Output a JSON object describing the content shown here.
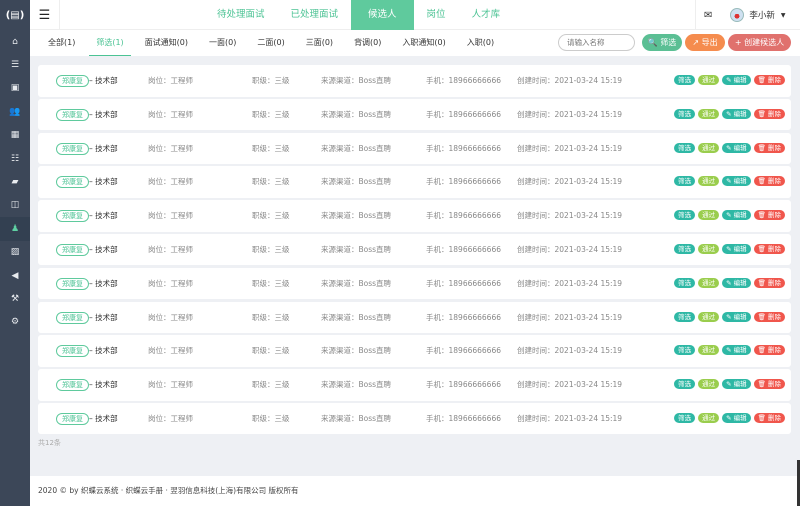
{
  "sidebar": {
    "logo": "(▤)",
    "items": [
      {
        "icon": "home-icon",
        "glyph": "⌂"
      },
      {
        "icon": "list-icon",
        "glyph": "☰"
      },
      {
        "icon": "briefcase-icon",
        "glyph": "▣"
      },
      {
        "icon": "users-icon",
        "glyph": "👥"
      },
      {
        "icon": "calendar-icon",
        "glyph": "▦"
      },
      {
        "icon": "table-icon",
        "glyph": "☷"
      },
      {
        "icon": "book-icon",
        "glyph": "▰"
      },
      {
        "icon": "columns-icon",
        "glyph": "◫"
      },
      {
        "icon": "person-icon",
        "glyph": "♟"
      },
      {
        "icon": "image-icon",
        "glyph": "▨"
      },
      {
        "icon": "bullhorn-icon",
        "glyph": "◀"
      },
      {
        "icon": "gavel-icon",
        "glyph": "⚒"
      },
      {
        "icon": "cogs-icon",
        "glyph": "⚙"
      }
    ],
    "active_index": 8
  },
  "header": {
    "nav": [
      "待处理面试",
      "已处理面试",
      "候选人",
      "岗位",
      "人才库"
    ],
    "active_nav": 2,
    "user": "李小新"
  },
  "tabs": [
    "全部(1)",
    "筛选(1)",
    "面试通知(0)",
    "一面(0)",
    "二面(0)",
    "三面(0)",
    "背调(0)",
    "入职通知(0)",
    "入职(0)"
  ],
  "active_tab": 1,
  "search": {
    "placeholder": "请输入名称"
  },
  "actions": {
    "filter": "🔍 筛选",
    "export": "↗ 导出",
    "create": "+ 创建候选人"
  },
  "row_ops": {
    "filter": "筛选",
    "pass": "通过",
    "edit": "✎ 编辑",
    "delete": "🗑 删除"
  },
  "rows": [
    {
      "name": "郑康复",
      "dept": "– 技术部",
      "position": "岗位：工程师",
      "level": "职级：三级",
      "source": "来源渠道：Boss直聘",
      "phone": "手机：18966666666",
      "created": "创建时间：2021-03-24 15:19"
    },
    {
      "name": "郑康复",
      "dept": "– 技术部",
      "position": "岗位：工程师",
      "level": "职级：三级",
      "source": "来源渠道：Boss直聘",
      "phone": "手机：18966666666",
      "created": "创建时间：2021-03-24 15:19"
    },
    {
      "name": "郑康复",
      "dept": "– 技术部",
      "position": "岗位：工程师",
      "level": "职级：三级",
      "source": "来源渠道：Boss直聘",
      "phone": "手机：18966666666",
      "created": "创建时间：2021-03-24 15:19"
    },
    {
      "name": "郑康复",
      "dept": "– 技术部",
      "position": "岗位：工程师",
      "level": "职级：三级",
      "source": "来源渠道：Boss直聘",
      "phone": "手机：18966666666",
      "created": "创建时间：2021-03-24 15:19"
    },
    {
      "name": "郑康复",
      "dept": "– 技术部",
      "position": "岗位：工程师",
      "level": "职级：三级",
      "source": "来源渠道：Boss直聘",
      "phone": "手机：18966666666",
      "created": "创建时间：2021-03-24 15:19"
    },
    {
      "name": "郑康复",
      "dept": "– 技术部",
      "position": "岗位：工程师",
      "level": "职级：三级",
      "source": "来源渠道：Boss直聘",
      "phone": "手机：18966666666",
      "created": "创建时间：2021-03-24 15:19"
    },
    {
      "name": "郑康复",
      "dept": "– 技术部",
      "position": "岗位：工程师",
      "level": "职级：三级",
      "source": "来源渠道：Boss直聘",
      "phone": "手机：18966666666",
      "created": "创建时间：2021-03-24 15:19"
    },
    {
      "name": "郑康复",
      "dept": "– 技术部",
      "position": "岗位：工程师",
      "level": "职级：三级",
      "source": "来源渠道：Boss直聘",
      "phone": "手机：18966666666",
      "created": "创建时间：2021-03-24 15:19"
    },
    {
      "name": "郑康复",
      "dept": "– 技术部",
      "position": "岗位：工程师",
      "level": "职级：三级",
      "source": "来源渠道：Boss直聘",
      "phone": "手机：18966666666",
      "created": "创建时间：2021-03-24 15:19"
    },
    {
      "name": "郑康复",
      "dept": "– 技术部",
      "position": "岗位：工程师",
      "level": "职级：三级",
      "source": "来源渠道：Boss直聘",
      "phone": "手机：18966666666",
      "created": "创建时间：2021-03-24 15:19"
    },
    {
      "name": "郑康复",
      "dept": "– 技术部",
      "position": "岗位：工程师",
      "level": "职级：三级",
      "source": "来源渠道：Boss直聘",
      "phone": "手机：18966666666",
      "created": "创建时间：2021-03-24 15:19"
    }
  ],
  "count": "共12条",
  "footer": "2020 © by 织蝶云系统 · 织蝶云手册 · 翌羽信息科技(上海)有限公司 版权所有"
}
